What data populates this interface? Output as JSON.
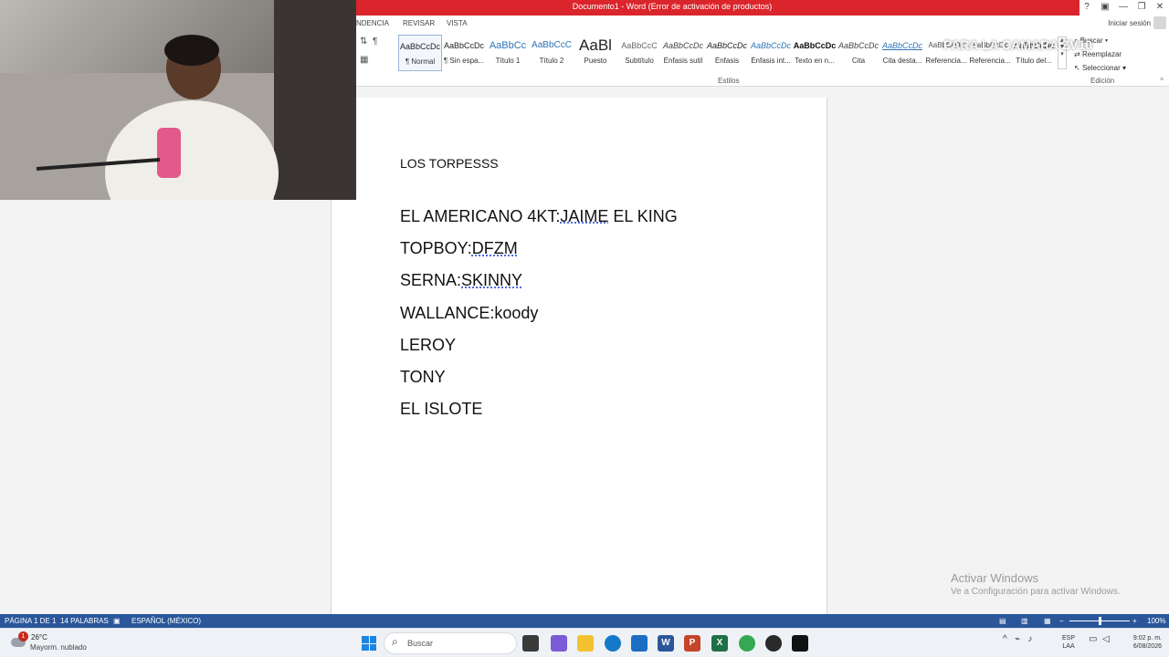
{
  "titlebar": {
    "title": "Documento1 -  Word (Error de activación de productos)",
    "controls": [
      "?",
      "▣",
      "—",
      "❐",
      "✕"
    ]
  },
  "ribbon_tabs": [
    {
      "label": "NDENCIA"
    },
    {
      "label": "REVISAR"
    },
    {
      "label": "VISTA"
    }
  ],
  "signin": "Iniciar sesión",
  "styles": [
    {
      "sample": "AaBbCcDc",
      "name": "¶ Normal",
      "color": "#222222"
    },
    {
      "sample": "AaBbCcDc",
      "name": "¶ Sin espa...",
      "color": "#222222"
    },
    {
      "sample": "AaBbCc",
      "name": "Título 1",
      "color": "#2e74b5"
    },
    {
      "sample": "AaBbCcC",
      "name": "Título 2",
      "color": "#2e74b5"
    },
    {
      "sample": "AaBl",
      "name": "Puesto",
      "color": "#222222"
    },
    {
      "sample": "AaBbCcC",
      "name": "Subtítulo",
      "color": "#666666"
    },
    {
      "sample": "AaBbCcDc",
      "name": "Énfasis sutil",
      "color": "#444444"
    },
    {
      "sample": "AaBbCcDc",
      "name": "Énfasis",
      "color": "#222222"
    },
    {
      "sample": "AaBbCcDc",
      "name": "Énfasis int...",
      "color": "#2e74b5"
    },
    {
      "sample": "AaBbCcDc",
      "name": "Texto en n...",
      "color": "#111111"
    },
    {
      "sample": "AaBbCcDc",
      "name": "Cita",
      "color": "#444444"
    },
    {
      "sample": "AaBbCcDc",
      "name": "Cita desta...",
      "color": "#2e74b5"
    },
    {
      "sample": "AaBbCcDc",
      "name": "Referencia...",
      "color": "#555555"
    },
    {
      "sample": "AaBbCcDc",
      "name": "Referencia...",
      "color": "#555555"
    },
    {
      "sample": "AaBbCcDc",
      "name": "Título del...",
      "color": "#222222"
    }
  ],
  "groups": {
    "styles_label": "Estilos",
    "edit_label": "Edición"
  },
  "edit_buttons": [
    "Buscar",
    "Reemplazar",
    "Seleccionar"
  ],
  "overlay_text": "PARA LA CAMARA ZV10",
  "document": {
    "title": "LOS TORPESSS",
    "lines": [
      {
        "pre": "EL AMERICANO 4KT:",
        "flag": "JAIME",
        "post": " EL KING"
      },
      {
        "pre": "TOPBOY:",
        "flag": "DFZM",
        "post": ""
      },
      {
        "pre": "SERNA:",
        "flag": "SKINNY",
        "post": ""
      },
      {
        "pre": "WALLANCE:koody",
        "flag": "",
        "post": ""
      },
      {
        "pre": "LEROY",
        "flag": "",
        "post": ""
      },
      {
        "pre": "TONY",
        "flag": "",
        "post": ""
      },
      {
        "pre": "EL ISLOTE",
        "flag": "",
        "post": ""
      }
    ]
  },
  "watermark": {
    "line1": "Activar Windows",
    "line2": "Ve a Configuración para activar Windows."
  },
  "statusbar": {
    "page": "PÁGINA 1 DE 1",
    "words": "14 PALABRAS",
    "language": "ESPAÑOL (MÉXICO)",
    "zoom": "100%"
  },
  "taskbar": {
    "weather_temp": "26°C",
    "weather_desc": "Mayorm. nublado",
    "notification_count": "1",
    "search_placeholder": "Buscar",
    "lang_line1": "ESP",
    "lang_line2": "LAA",
    "time": "9:02 p. m.",
    "date": "6/08/2026",
    "apps": [
      {
        "name": "task-view",
        "color": "#3a3a3a",
        "letter": ""
      },
      {
        "name": "copilot",
        "color": "#7b5cd6",
        "letter": ""
      },
      {
        "name": "file-explorer",
        "color": "#f2c230",
        "letter": ""
      },
      {
        "name": "edge",
        "color": "#1479c9",
        "letter": ""
      },
      {
        "name": "store",
        "color": "#1a6fc4",
        "letter": ""
      },
      {
        "name": "word",
        "color": "#2b579a",
        "letter": "W"
      },
      {
        "name": "powerpoint",
        "color": "#c4452a",
        "letter": "P"
      },
      {
        "name": "excel",
        "color": "#1e7145",
        "letter": "X"
      },
      {
        "name": "chrome",
        "color": "#34a853",
        "letter": ""
      },
      {
        "name": "obs",
        "color": "#2a2a2a",
        "letter": ""
      },
      {
        "name": "capcut",
        "color": "#111111",
        "letter": ""
      }
    ]
  }
}
